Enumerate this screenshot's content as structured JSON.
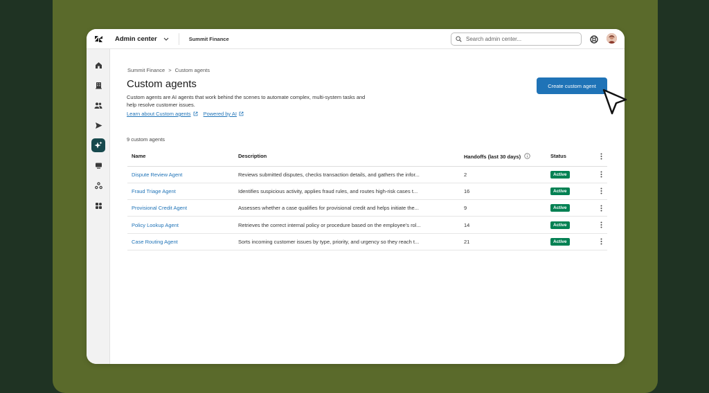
{
  "topbar": {
    "app_name": "Admin center",
    "account_name": "Summit Finance",
    "search_placeholder": "Search admin center..."
  },
  "sidebar": {
    "items": [
      {
        "icon": "home-icon"
      },
      {
        "icon": "building-icon"
      },
      {
        "icon": "people-icon"
      },
      {
        "icon": "send-icon"
      },
      {
        "icon": "ai-sparkle-icon",
        "active": true
      },
      {
        "icon": "chat-icon"
      },
      {
        "icon": "recycle-icon"
      },
      {
        "icon": "apps-icon"
      }
    ]
  },
  "breadcrumb": {
    "parent": "Summit Finance",
    "separator": ">",
    "current": "Custom agents"
  },
  "page": {
    "title": "Custom agents",
    "description": "Custom agents are AI agents that work behind the scenes to automate complex, multi-system tasks and help resolve customer issues.",
    "link_learn": "Learn about Custom agents",
    "link_powered": "Powered by AI",
    "create_button": "Create custom agent",
    "count_label": "9 custom agents"
  },
  "table": {
    "headers": {
      "name": "Name",
      "description": "Description",
      "handoffs": "Handoffs (last 30 days)",
      "status": "Status"
    },
    "rows": [
      {
        "name": "Dispute Review Agent",
        "description": "Reviews submitted disputes, checks transaction details, and gathers the infor...",
        "handoffs": "2",
        "status": "Active"
      },
      {
        "name": "Fraud Triage Agent",
        "description": "Identifies suspicious activity, applies fraud rules, and routes high-risk cases t...",
        "handoffs": "16",
        "status": "Active"
      },
      {
        "name": "Provisional Credit Agent",
        "description": "Assesses whether a case qualifies for provisional credit and helps initiate the...",
        "handoffs": "9",
        "status": "Active"
      },
      {
        "name": "Policy Lookup Agent",
        "description": "Retrieves the correct internal policy or procedure based on the employee's rol...",
        "handoffs": "14",
        "status": "Active"
      },
      {
        "name": "Case Routing Agent",
        "description": "Sorts incoming customer issues by type, priority, and urgency so they reach t...",
        "handoffs": "21",
        "status": "Active"
      }
    ]
  },
  "colors": {
    "background": "#1f3323",
    "frame": "#5a6a2b",
    "primary": "#1f73b7",
    "active_badge": "#038153",
    "sidebar_active": "#17494d"
  }
}
